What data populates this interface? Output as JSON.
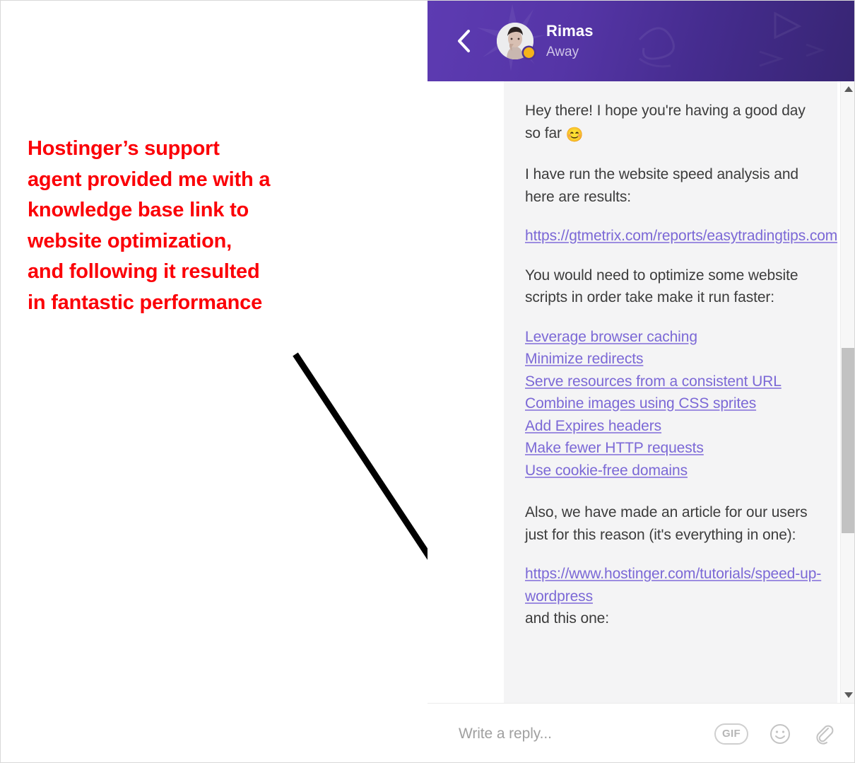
{
  "annotation": {
    "callout_text": "Hostinger’s support\nagent provided me with a\nknowledge base link to\nwebsite optimization,\nand following it resulted\nin fantastic performance",
    "callout_color": "#fb0007",
    "arrow_color": "#000000",
    "arrow_name": "annotation-arrow"
  },
  "chat": {
    "header": {
      "back_icon": "chevron-left-icon",
      "agent_name": "Rimas",
      "agent_status": "Away",
      "status_dot_color": "#f5b31a",
      "gradient_from": "#5d3bb2",
      "gradient_to": "#372573"
    },
    "messages": [
      {
        "type": "text",
        "text": "Hey there! I hope you're having a good day so far",
        "emoji": "😊"
      },
      {
        "type": "text",
        "text": "I have run the website speed analysis and here are results:"
      },
      {
        "type": "link",
        "text": "https://gtmetrix.com/reports/easytradingtips.com/vpxMskgd"
      },
      {
        "type": "text",
        "text": "You would need to optimize some website scripts in order take make it run faster:"
      },
      {
        "type": "link-list",
        "links": [
          "Leverage browser caching",
          "Minimize redirects",
          "Serve resources from a consistent URL",
          "Combine images using CSS sprites",
          "Add Expires headers",
          "Make fewer HTTP requests",
          "Use cookie-free domains"
        ]
      },
      {
        "type": "text",
        "text": "Also, we have made an article for our users just for this reason (it's everything in one):"
      },
      {
        "type": "link",
        "text": "https://www.hostinger.com/tutorials/speed-up-wordpress"
      },
      {
        "type": "text",
        "text": "and this one:",
        "truncated": true
      }
    ],
    "message_text_color": "#3c3c3c",
    "link_color": "#7b68d6",
    "scrollbar": {
      "up_arrow_icon": "scroll-up-arrow-icon",
      "down_arrow_icon": "scroll-down-arrow-icon",
      "thumb_color": "#c2c2c2"
    },
    "footer": {
      "reply_placeholder": "Write a reply...",
      "gif_label": "GIF",
      "emoji_icon": "smiley-icon",
      "attachment_icon": "paperclip-icon"
    }
  }
}
